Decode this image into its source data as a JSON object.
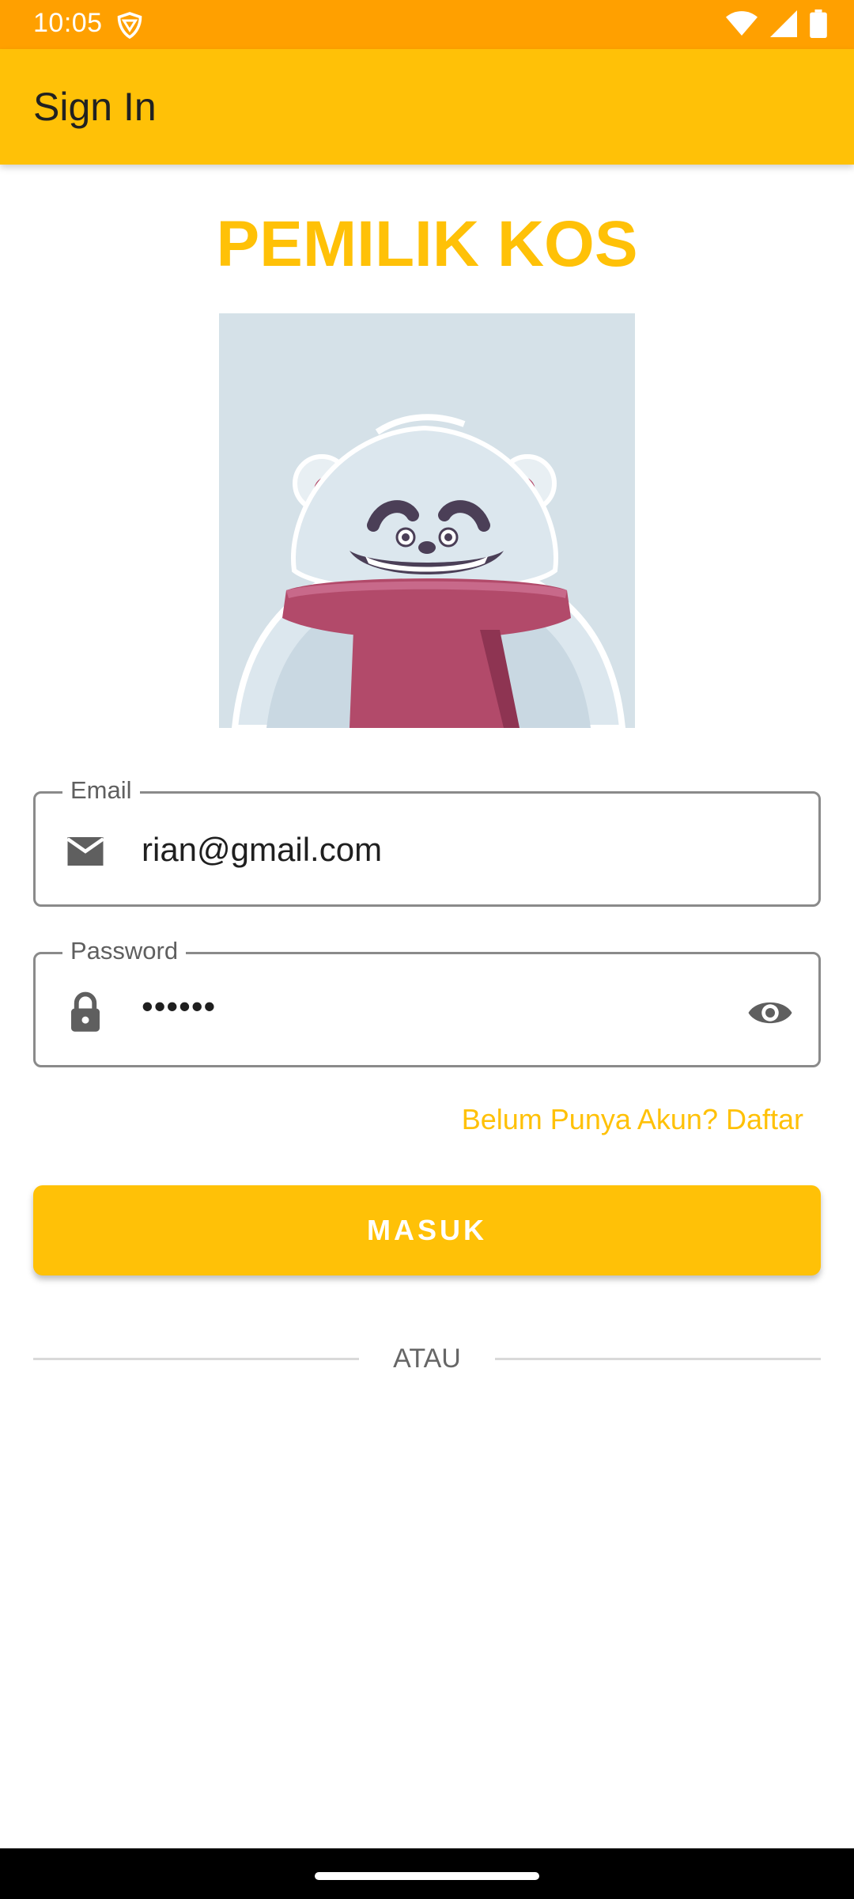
{
  "status_bar": {
    "time": "10:05",
    "icons": [
      "vpn-shield-icon",
      "wifi-icon",
      "cellular-signal-icon",
      "battery-icon"
    ]
  },
  "appbar": {
    "title": "Sign In"
  },
  "main": {
    "heading": "PEMILIK KOS",
    "email": {
      "label": "Email",
      "value": "rian@gmail.com",
      "icon": "email-icon"
    },
    "password": {
      "label": "Password",
      "value": "••••••",
      "icon": "lock-icon",
      "toggle_icon": "eye-icon"
    },
    "register_link": "Belum Punya Akun? Daftar",
    "login_button": "MASUK",
    "divider_text": "ATAU"
  },
  "colors": {
    "status_bar": "#FFA000",
    "primary": "#FFC107",
    "illustration_bg": "#D5E1E8"
  }
}
